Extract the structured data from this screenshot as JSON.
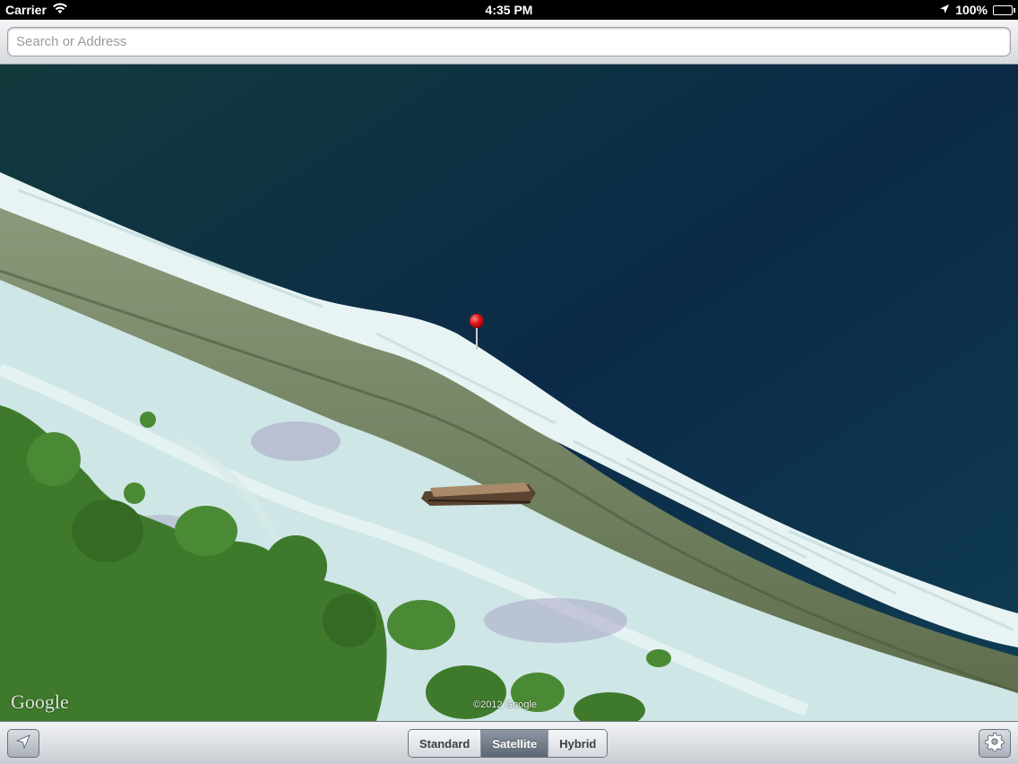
{
  "status_bar": {
    "carrier": "Carrier",
    "time": "4:35 PM",
    "battery": "100%",
    "icons": [
      "wifi-icon",
      "location-arrow-icon",
      "battery-icon"
    ]
  },
  "search": {
    "placeholder": "Search or Address",
    "value": ""
  },
  "map": {
    "mode": "satellite",
    "logo": "Google",
    "copyright": "©2012 Google",
    "pin_color": "#e0141b",
    "colors": {
      "ocean": "#0d2a45",
      "surf": "#e6f2f2",
      "reef": "#7f8f6a",
      "sand": "#c9e3e3",
      "vegetation": "#3f7a2c"
    }
  },
  "toolbar": {
    "locate_icon": "location-arrow-icon",
    "map_types": [
      {
        "label": "Standard",
        "selected": false
      },
      {
        "label": "Satellite",
        "selected": true
      },
      {
        "label": "Hybrid",
        "selected": false
      }
    ],
    "settings_icon": "gear-icon"
  }
}
